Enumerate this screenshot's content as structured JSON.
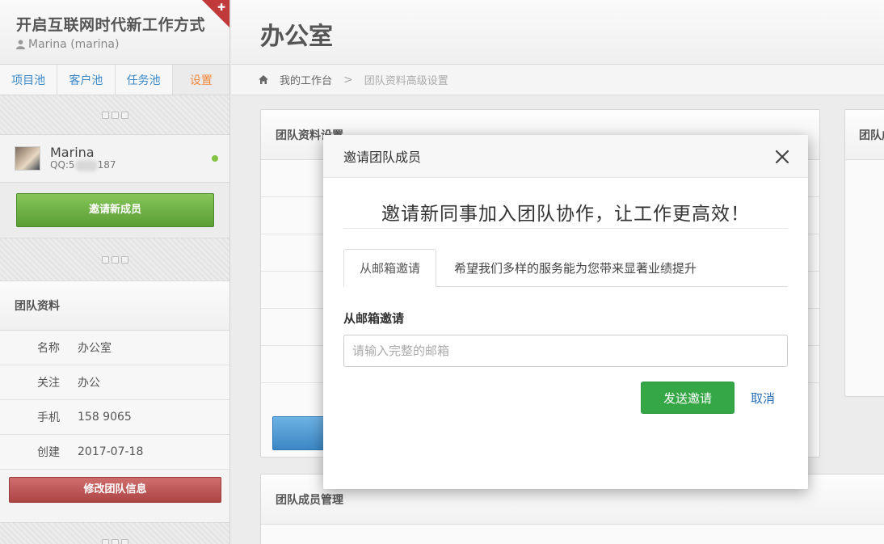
{
  "sidebar": {
    "brand_title": "开启互联网时代新工作方式",
    "brand_user": "Marina (marina)",
    "tabs": [
      {
        "label": "项目池"
      },
      {
        "label": "客户池"
      },
      {
        "label": "任务池"
      },
      {
        "label": "设置"
      }
    ],
    "member": {
      "name": "Marina",
      "qq_prefix": "QQ:5",
      "qq_suffix": "187"
    },
    "invite_button": "邀请新成员",
    "team_section_title": "团队资料",
    "team_info": [
      {
        "label": "名称",
        "value": "办公室"
      },
      {
        "label": "关注",
        "value": "办公"
      },
      {
        "label": "手机",
        "value": "158    9065"
      },
      {
        "label": "创建",
        "value": "2017-07-18"
      }
    ],
    "edit_button": "修改团队信息"
  },
  "main": {
    "page_title": "办公室",
    "breadcrumb": {
      "home": "我的工作台",
      "separator": ">",
      "current": "团队资料高级设置"
    },
    "panels": {
      "settings_title": "团队资料设置",
      "right_title": "团队成员",
      "members_title": "团队成员管理"
    }
  },
  "modal": {
    "title": "邀请团队成员",
    "headline": "邀请新同事加入团队协作，让工作更高效！",
    "tabs": [
      {
        "label": "从邮箱邀请"
      },
      {
        "label": "希望我们多样的服务能为您带来显著业绩提升"
      }
    ],
    "field_label": "从邮箱邀请",
    "email_placeholder": "请输入完整的邮箱",
    "send_button": "发送邀请",
    "cancel_button": "取消"
  },
  "colors": {
    "accent_tab": "#f0883c",
    "link": "#3a88c8",
    "green": "#36a746",
    "red": "#ae4545"
  }
}
